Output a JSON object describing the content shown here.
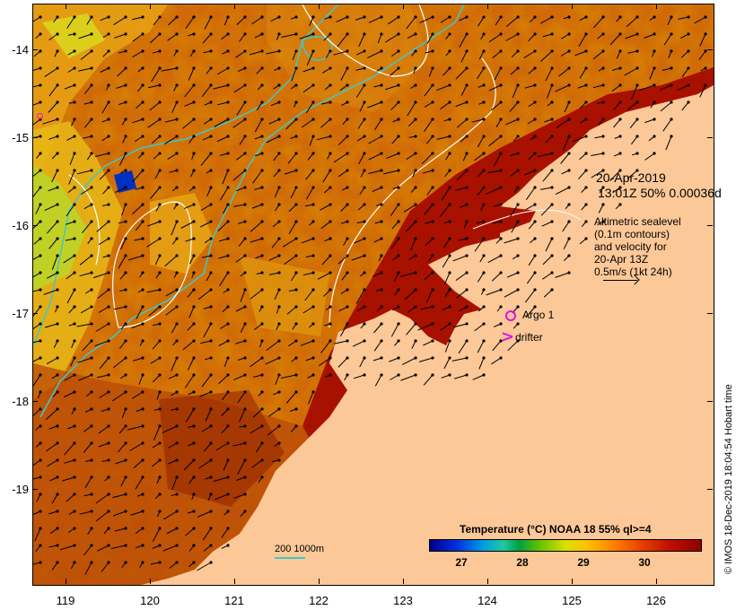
{
  "map": {
    "y_axis_labels": [
      "-14",
      "-15",
      "-16",
      "-17",
      "-18",
      "-19"
    ],
    "x_axis_labels": [
      "119",
      "120",
      "121",
      "122",
      "123",
      "124",
      "125",
      "126"
    ],
    "date": "20-Apr-2019",
    "time_info": "13:01Z  50% 0.00036d",
    "sealevel_lines": [
      "Altimetric sealevel",
      "(0.1m contours)",
      "and velocity for",
      "20-Apr 13Z",
      "0.5m/s (1kt 24h)"
    ],
    "argo_label": "Argo 1",
    "drifter_label": "drifter",
    "credit": "© IMOS 18-Dec-2019 18:04:54 Hobart time",
    "scale_label": "200  1000m",
    "colors": {
      "land": "#fcc898",
      "argo": "#e010e0",
      "bathymetry_contour": "#40c8c8",
      "sealevel_contour": "#ffffff"
    }
  },
  "legend": {
    "title": "Temperature (°C) NOAA 18 55% ql>=4",
    "ticks": [
      "27",
      "28",
      "29",
      "30"
    ]
  }
}
